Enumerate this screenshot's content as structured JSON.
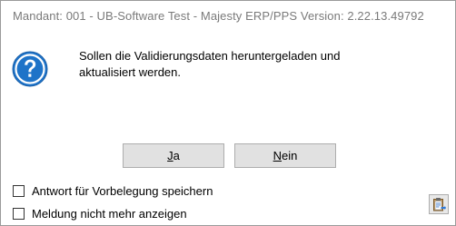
{
  "window": {
    "title": "Mandant: 001 - UB-Software Test - Majesty ERP/PPS Version: 2.22.13.49792"
  },
  "dialog": {
    "icon": "question-icon",
    "message_lines": [
      "Sollen die Validierungsdaten heruntergeladen und",
      "aktualisiert werden."
    ]
  },
  "buttons": {
    "yes": {
      "mnemonic": "J",
      "rest": "a"
    },
    "no": {
      "mnemonic": "N",
      "rest": "ein"
    }
  },
  "options": [
    {
      "label": "Antwort für Vorbelegung speichern",
      "checked": false
    },
    {
      "label": "Meldung nicht mehr anzeigen",
      "checked": false
    }
  ],
  "clipboard_button": {
    "icon": "clipboard-icon"
  },
  "colors": {
    "icon_blue": "#1e73c8",
    "button_bg": "#e1e1e1",
    "title_text": "#7a7a7a"
  }
}
